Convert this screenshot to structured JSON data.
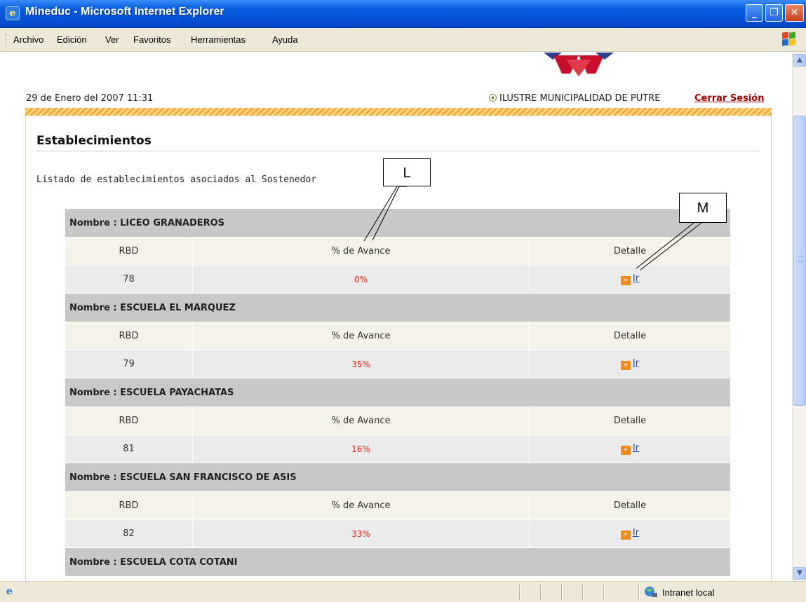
{
  "window": {
    "title": "Mineduc - Microsoft Internet Explorer",
    "min_glyph": "_",
    "max_glyph": "❐",
    "close_glyph": "✕"
  },
  "menu": [
    "Archivo",
    "Edición",
    "Ver",
    "Favoritos",
    "Herramientas",
    "Ayuda"
  ],
  "header": {
    "datetime": "29 de Enero del 2007 11:31",
    "municipality": "ILUSTRE MUNICIPALIDAD DE PUTRE",
    "logout": "Cerrar Sesión"
  },
  "page": {
    "heading": "Establecimientos",
    "subtitle": "Listado de establecimientos asociados al Sostenedor"
  },
  "table": {
    "col_rbd": "RBD",
    "col_avance": "% de Avance",
    "col_detalle": "Detalle",
    "link_label": "Ir",
    "establishments": [
      {
        "name": "Nombre : LICEO GRANADEROS",
        "rbd": "78",
        "avance": "0%"
      },
      {
        "name": "Nombre : ESCUELA EL MARQUEZ",
        "rbd": "79",
        "avance": "35%"
      },
      {
        "name": "Nombre : ESCUELA PAYACHATAS",
        "rbd": "81",
        "avance": "16%"
      },
      {
        "name": "Nombre : ESCUELA SAN FRANCISCO DE ASIS",
        "rbd": "82",
        "avance": "33%"
      },
      {
        "name": "Nombre : ESCUELA COTA COTANI"
      }
    ]
  },
  "annotations": {
    "l": "L",
    "m": "M"
  },
  "statusbar": {
    "zone": "Intranet local"
  },
  "icons": {
    "app": "ie-icon",
    "go": "double-arrow-icon",
    "municipality_bullet": "target-bullet-icon",
    "zone": "intranet-icon"
  },
  "colors": {
    "percent": "#e8231a",
    "logout": "#a00000",
    "name_row": "#c8c8c8",
    "stripe": "#f0a93a"
  }
}
